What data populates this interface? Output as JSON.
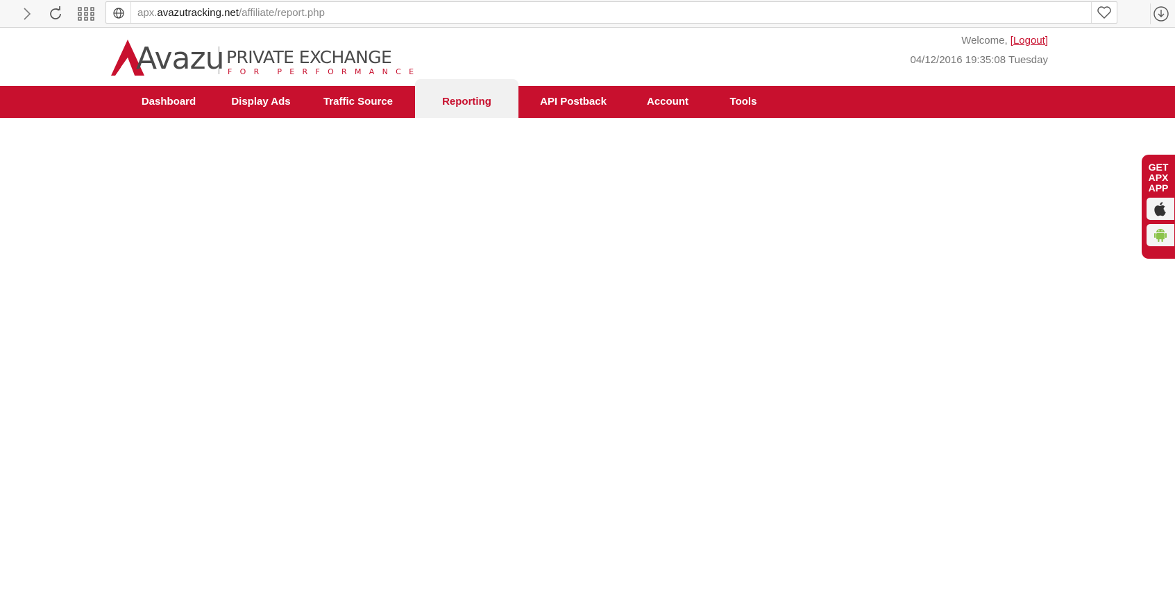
{
  "browser": {
    "url_prefix": "apx.",
    "url_domain": "avazutracking.net",
    "url_path": "/affiliate/report.php"
  },
  "header": {
    "logo_brand": "Avazu",
    "logo_title": "PRIVATE EXCHANGE",
    "logo_tagline": "FOR PERFORMANCE",
    "welcome_text": "Welcome, ",
    "logout_label": "[Logout]",
    "datetime": "04/12/2016 19:35:08 Tuesday"
  },
  "nav": {
    "items": [
      {
        "label": "Dashboard"
      },
      {
        "label": "Display Ads"
      },
      {
        "label": "Traffic Source"
      },
      {
        "label": "Reporting"
      },
      {
        "label": "API Postback"
      },
      {
        "label": "Account"
      },
      {
        "label": "Tools"
      }
    ],
    "active": "Reporting"
  },
  "app_widget": {
    "title": "GET\nAPX\nAPP",
    "buttons": [
      "apple-icon",
      "android-icon"
    ]
  },
  "colors": {
    "brand_red": "#c8102e",
    "android_green": "#8bc34a"
  }
}
